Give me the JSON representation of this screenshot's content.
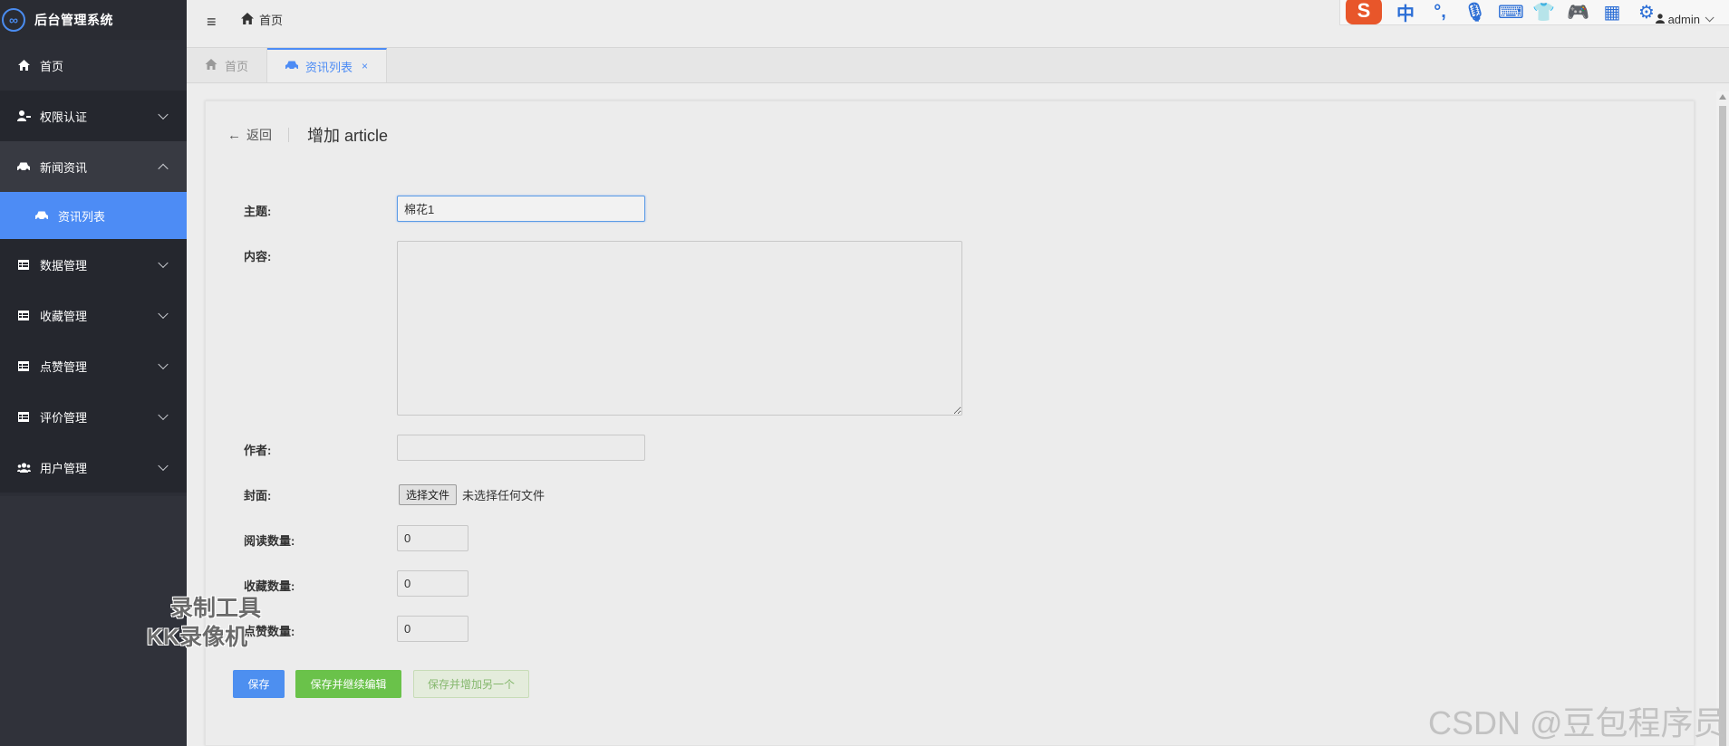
{
  "app": {
    "title": "后台管理系统"
  },
  "sidebar": {
    "items": [
      {
        "label": "首页",
        "icon": "home-icon"
      },
      {
        "label": "权限认证",
        "icon": "user-key-icon"
      },
      {
        "label": "新闻资讯",
        "icon": "car-icon",
        "expanded": true,
        "children": [
          {
            "label": "资讯列表",
            "icon": "car-icon",
            "active": true
          }
        ]
      },
      {
        "label": "数据管理",
        "icon": "table-icon"
      },
      {
        "label": "收藏管理",
        "icon": "table-icon"
      },
      {
        "label": "点赞管理",
        "icon": "table-icon"
      },
      {
        "label": "评价管理",
        "icon": "table-icon"
      },
      {
        "label": "用户管理",
        "icon": "users-icon"
      }
    ]
  },
  "topbar": {
    "breadcrumb": "首页",
    "username": "admin"
  },
  "ime_toolbar": {
    "logo": "S",
    "glyphs": [
      "中",
      "°,",
      "🎙",
      "⌨",
      "👕",
      "🎮",
      "▦",
      "⚙"
    ]
  },
  "tabs": [
    {
      "label": "首页",
      "icon": "home-icon",
      "active": false
    },
    {
      "label": "资讯列表",
      "icon": "car-icon",
      "active": true,
      "closable": true,
      "close": "×"
    }
  ],
  "form": {
    "back_label": "返回",
    "back_arrow": "←",
    "title": "增加 article",
    "fields": {
      "subject": {
        "label": "主题:",
        "value": "棉花1"
      },
      "content": {
        "label": "内容:",
        "value": ""
      },
      "author": {
        "label": "作者:",
        "value": ""
      },
      "cover": {
        "label": "封面:",
        "button": "选择文件",
        "status": "未选择任何文件"
      },
      "read_count": {
        "label": "阅读数量:",
        "value": "0"
      },
      "fav_count": {
        "label": "收藏数量:",
        "value": "0"
      },
      "like_count": {
        "label": "点赞数量:",
        "value": "0"
      }
    },
    "buttons": {
      "save": "保存",
      "save_continue": "保存并继续编辑",
      "save_add": "保存并增加另一个"
    }
  },
  "watermarks": {
    "recorder_line1": "录制工具",
    "recorder_line2": "KK录像机",
    "csdn": "CSDN @豆包程序员"
  },
  "colors": {
    "sidebar_bg": "#2c2e36",
    "accent": "#4d8cf5",
    "green": "#6ac24a"
  }
}
